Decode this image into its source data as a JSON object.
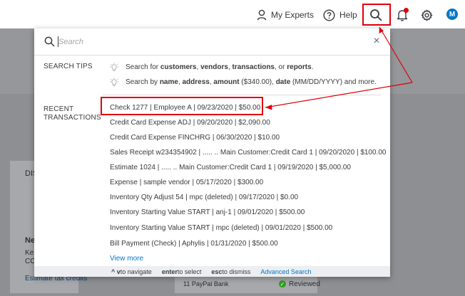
{
  "topbar": {
    "my_experts_label": "My Experts",
    "help_label": "Help",
    "avatar_initial": "M"
  },
  "background": {
    "panel_heading_fragment": "DIS",
    "card_title_fragment": "Ne",
    "card_line_1_fragment": "Ke",
    "card_line_2_fragment": "CC",
    "estimate_link": "Estimate tax credits",
    "bank_row_label": "11 PayPal Bank",
    "bank_status": "Reviewed"
  },
  "search": {
    "placeholder": "Search",
    "value": ""
  },
  "search_tips": {
    "label": "SEARCH TIPS",
    "tip1": {
      "prefix": "Search for ",
      "b1": "customers",
      "s1": ", ",
      "b2": "vendors",
      "s2": ", ",
      "b3": "transactions",
      "s3": ", or ",
      "b4": "reports",
      "suffix": "."
    },
    "tip2": {
      "prefix": "Search by ",
      "b1": "name",
      "s1": ", ",
      "b2": "address",
      "s2": ", ",
      "b3": "amount",
      "s3": " ($340.00), ",
      "b4": "date",
      "suffix": " (MM/DD/YYYY) and more."
    }
  },
  "recent": {
    "label_line1": "RECENT",
    "label_line2": "TRANSACTIONS",
    "items": [
      "Check 1277 | Employee A | 09/23/2020 | $50.00",
      "Credit Card Expense ADJ | 09/20/2020 | $2,090.00",
      "Credit Card Expense FINCHRG | 06/30/2020 | $10.00",
      "Sales Receipt w234354902 | ..... .. Main Customer:Credit Card 1 | 09/20/2020 | $100.00",
      "Estimate 1024 | ..... .. Main Customer:Credit Card 1 | 09/19/2020 | $5,000.00",
      "Expense  | sample vendor | 05/17/2020 | $300.00",
      "Inventory Qty Adjust 54 | mpc (deleted) | 09/17/2020 | $0.00",
      "Inventory Starting Value START | anj-1 | 09/01/2020 | $500.00",
      "Inventory Starting Value START | mpc (deleted) | 09/01/2020 | $500.00",
      "Bill Payment (Check)  | Aphylis | 01/31/2020 | $500.00"
    ],
    "view_more": "View more"
  },
  "footer": {
    "nav_keys": "^ v",
    "nav_text": " to navigate",
    "enter_key": "enter",
    "enter_text": " to select",
    "esc_key": "esc",
    "esc_text": " to dismiss",
    "advanced_search": "Advanced Search"
  },
  "colors": {
    "annotation_red": "#e0000c",
    "link_blue": "#0077c5",
    "success_green": "#2ca01c"
  }
}
